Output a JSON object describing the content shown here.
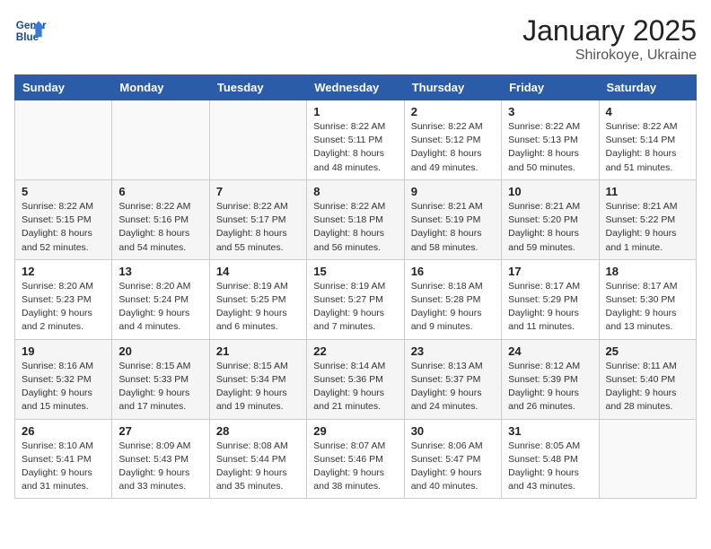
{
  "header": {
    "logo_line1": "General",
    "logo_line2": "Blue",
    "month": "January 2025",
    "location": "Shirokoye, Ukraine"
  },
  "weekdays": [
    "Sunday",
    "Monday",
    "Tuesday",
    "Wednesday",
    "Thursday",
    "Friday",
    "Saturday"
  ],
  "weeks": [
    [
      {
        "day": "",
        "info": ""
      },
      {
        "day": "",
        "info": ""
      },
      {
        "day": "",
        "info": ""
      },
      {
        "day": "1",
        "info": "Sunrise: 8:22 AM\nSunset: 5:11 PM\nDaylight: 8 hours\nand 48 minutes."
      },
      {
        "day": "2",
        "info": "Sunrise: 8:22 AM\nSunset: 5:12 PM\nDaylight: 8 hours\nand 49 minutes."
      },
      {
        "day": "3",
        "info": "Sunrise: 8:22 AM\nSunset: 5:13 PM\nDaylight: 8 hours\nand 50 minutes."
      },
      {
        "day": "4",
        "info": "Sunrise: 8:22 AM\nSunset: 5:14 PM\nDaylight: 8 hours\nand 51 minutes."
      }
    ],
    [
      {
        "day": "5",
        "info": "Sunrise: 8:22 AM\nSunset: 5:15 PM\nDaylight: 8 hours\nand 52 minutes."
      },
      {
        "day": "6",
        "info": "Sunrise: 8:22 AM\nSunset: 5:16 PM\nDaylight: 8 hours\nand 54 minutes."
      },
      {
        "day": "7",
        "info": "Sunrise: 8:22 AM\nSunset: 5:17 PM\nDaylight: 8 hours\nand 55 minutes."
      },
      {
        "day": "8",
        "info": "Sunrise: 8:22 AM\nSunset: 5:18 PM\nDaylight: 8 hours\nand 56 minutes."
      },
      {
        "day": "9",
        "info": "Sunrise: 8:21 AM\nSunset: 5:19 PM\nDaylight: 8 hours\nand 58 minutes."
      },
      {
        "day": "10",
        "info": "Sunrise: 8:21 AM\nSunset: 5:20 PM\nDaylight: 8 hours\nand 59 minutes."
      },
      {
        "day": "11",
        "info": "Sunrise: 8:21 AM\nSunset: 5:22 PM\nDaylight: 9 hours\nand 1 minute."
      }
    ],
    [
      {
        "day": "12",
        "info": "Sunrise: 8:20 AM\nSunset: 5:23 PM\nDaylight: 9 hours\nand 2 minutes."
      },
      {
        "day": "13",
        "info": "Sunrise: 8:20 AM\nSunset: 5:24 PM\nDaylight: 9 hours\nand 4 minutes."
      },
      {
        "day": "14",
        "info": "Sunrise: 8:19 AM\nSunset: 5:25 PM\nDaylight: 9 hours\nand 6 minutes."
      },
      {
        "day": "15",
        "info": "Sunrise: 8:19 AM\nSunset: 5:27 PM\nDaylight: 9 hours\nand 7 minutes."
      },
      {
        "day": "16",
        "info": "Sunrise: 8:18 AM\nSunset: 5:28 PM\nDaylight: 9 hours\nand 9 minutes."
      },
      {
        "day": "17",
        "info": "Sunrise: 8:17 AM\nSunset: 5:29 PM\nDaylight: 9 hours\nand 11 minutes."
      },
      {
        "day": "18",
        "info": "Sunrise: 8:17 AM\nSunset: 5:30 PM\nDaylight: 9 hours\nand 13 minutes."
      }
    ],
    [
      {
        "day": "19",
        "info": "Sunrise: 8:16 AM\nSunset: 5:32 PM\nDaylight: 9 hours\nand 15 minutes."
      },
      {
        "day": "20",
        "info": "Sunrise: 8:15 AM\nSunset: 5:33 PM\nDaylight: 9 hours\nand 17 minutes."
      },
      {
        "day": "21",
        "info": "Sunrise: 8:15 AM\nSunset: 5:34 PM\nDaylight: 9 hours\nand 19 minutes."
      },
      {
        "day": "22",
        "info": "Sunrise: 8:14 AM\nSunset: 5:36 PM\nDaylight: 9 hours\nand 21 minutes."
      },
      {
        "day": "23",
        "info": "Sunrise: 8:13 AM\nSunset: 5:37 PM\nDaylight: 9 hours\nand 24 minutes."
      },
      {
        "day": "24",
        "info": "Sunrise: 8:12 AM\nSunset: 5:39 PM\nDaylight: 9 hours\nand 26 minutes."
      },
      {
        "day": "25",
        "info": "Sunrise: 8:11 AM\nSunset: 5:40 PM\nDaylight: 9 hours\nand 28 minutes."
      }
    ],
    [
      {
        "day": "26",
        "info": "Sunrise: 8:10 AM\nSunset: 5:41 PM\nDaylight: 9 hours\nand 31 minutes."
      },
      {
        "day": "27",
        "info": "Sunrise: 8:09 AM\nSunset: 5:43 PM\nDaylight: 9 hours\nand 33 minutes."
      },
      {
        "day": "28",
        "info": "Sunrise: 8:08 AM\nSunset: 5:44 PM\nDaylight: 9 hours\nand 35 minutes."
      },
      {
        "day": "29",
        "info": "Sunrise: 8:07 AM\nSunset: 5:46 PM\nDaylight: 9 hours\nand 38 minutes."
      },
      {
        "day": "30",
        "info": "Sunrise: 8:06 AM\nSunset: 5:47 PM\nDaylight: 9 hours\nand 40 minutes."
      },
      {
        "day": "31",
        "info": "Sunrise: 8:05 AM\nSunset: 5:48 PM\nDaylight: 9 hours\nand 43 minutes."
      },
      {
        "day": "",
        "info": ""
      }
    ]
  ]
}
